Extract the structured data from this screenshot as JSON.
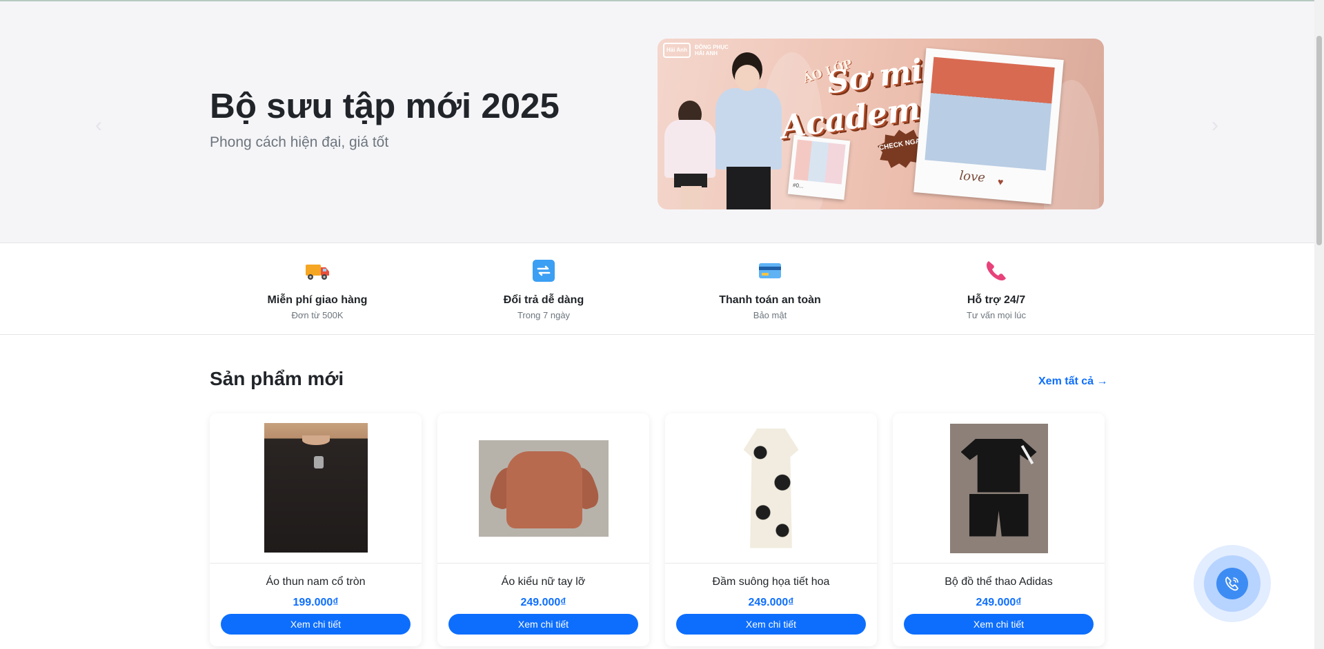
{
  "hero": {
    "title": "Bộ sưu tập mới 2025",
    "subtitle": "Phong cách hiện đại, giá tốt",
    "prev_arrow": "‹",
    "next_arrow": "›",
    "banner": {
      "brand_logo": "Hải Anh",
      "brand_line1": "ĐỒNG PHỤC",
      "brand_line2": "HẢI ANH",
      "kicker": "ÁO LỚP",
      "headline_line1": "Sơ mi",
      "headline_line2": "Academy",
      "badge": "CHECK NGAY",
      "polaroid_caption": "love",
      "small_polaroid_caption": "#0..."
    }
  },
  "features": [
    {
      "icon": "delivery-truck-icon",
      "title": "Miễn phí giao hàng",
      "subtitle": "Đơn từ 500K"
    },
    {
      "icon": "exchange-arrows-icon",
      "title": "Đổi trả dễ dàng",
      "subtitle": "Trong 7 ngày"
    },
    {
      "icon": "credit-card-icon",
      "title": "Thanh toán an toàn",
      "subtitle": "Bảo mật"
    },
    {
      "icon": "phone-icon",
      "title": "Hỗ trợ 24/7",
      "subtitle": "Tư vấn mọi lúc"
    }
  ],
  "products_section": {
    "title": "Sản phẩm mới",
    "view_all": "Xem tất cả →",
    "items": [
      {
        "name": "Áo thun nam cổ tròn",
        "price": "199.000₫",
        "button": "Xem chi tiết"
      },
      {
        "name": "Áo kiểu nữ tay lỡ",
        "price": "249.000₫",
        "button": "Xem chi tiết"
      },
      {
        "name": "Đầm suông họa tiết hoa",
        "price": "249.000₫",
        "button": "Xem chi tiết"
      },
      {
        "name": "Bộ đồ thể thao Adidas",
        "price": "249.000₫",
        "button": "Xem chi tiết"
      }
    ]
  },
  "floating_call": {
    "icon": "phone-call-icon"
  },
  "colors": {
    "primary": "#0d6efd",
    "hero_bg": "#f5f5f8",
    "text_dark": "#212529",
    "text_muted": "#6c757d"
  }
}
